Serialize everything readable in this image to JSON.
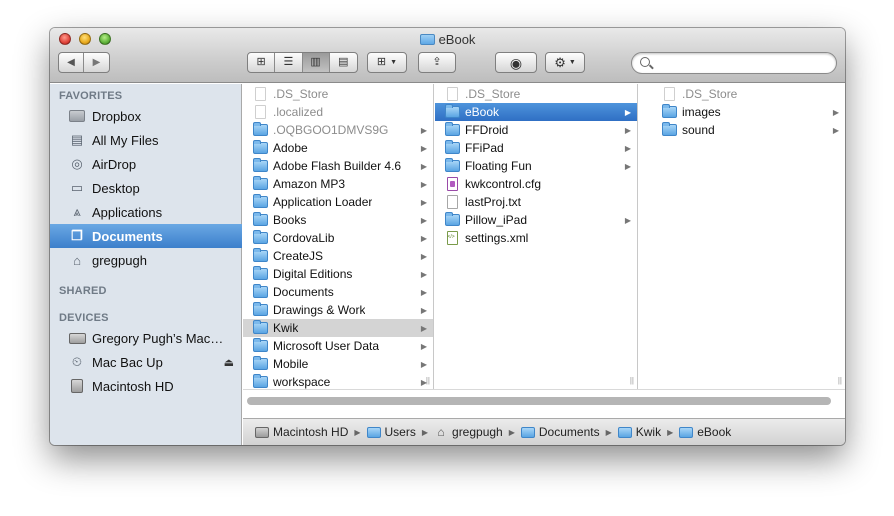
{
  "window": {
    "title": "eBook"
  },
  "toolbar": {
    "back_icon": "back-arrow-icon",
    "forward_icon": "forward-arrow-icon",
    "view_modes": [
      "icon-view",
      "list-view",
      "column-view",
      "cover-flow-view"
    ],
    "active_view": "column-view",
    "search": {
      "value": "",
      "placeholder": ""
    }
  },
  "sidebar": {
    "favorites_header": "FAVORITES",
    "favorites": [
      {
        "label": "Dropbox",
        "icon": "folder-icon"
      },
      {
        "label": "All My Files",
        "icon": "all-files-icon"
      },
      {
        "label": "AirDrop",
        "icon": "airdrop-icon"
      },
      {
        "label": "Desktop",
        "icon": "desktop-icon"
      },
      {
        "label": "Applications",
        "icon": "applications-icon"
      },
      {
        "label": "Documents",
        "icon": "documents-icon",
        "selected": true
      },
      {
        "label": "gregpugh",
        "icon": "home-icon"
      }
    ],
    "shared_header": "SHARED",
    "devices_header": "DEVICES",
    "devices": [
      {
        "label": "Gregory Pugh’s Mac…",
        "icon": "laptop-icon"
      },
      {
        "label": "Mac Bac Up",
        "icon": "external-disk-icon",
        "eject": "⏏"
      },
      {
        "label": "Macintosh HD",
        "icon": "hard-disk-icon"
      }
    ]
  },
  "columns": [
    {
      "items": [
        {
          "name": ".DS_Store",
          "type": "file",
          "dim": true
        },
        {
          "name": ".localized",
          "type": "file",
          "dim": true
        },
        {
          "name": ".OQBGOO1DMVS9G",
          "type": "folder",
          "dim": true,
          "chevron": true
        },
        {
          "name": "Adobe",
          "type": "folder",
          "chevron": true
        },
        {
          "name": "Adobe Flash Builder 4.6",
          "type": "folder",
          "chevron": true
        },
        {
          "name": "Amazon MP3",
          "type": "folder",
          "chevron": true
        },
        {
          "name": "Application Loader",
          "type": "folder",
          "chevron": true
        },
        {
          "name": "Books",
          "type": "folder",
          "chevron": true
        },
        {
          "name": "CordovaLib",
          "type": "folder",
          "chevron": true
        },
        {
          "name": "CreateJS",
          "type": "folder",
          "chevron": true
        },
        {
          "name": "Digital Editions",
          "type": "folder",
          "chevron": true
        },
        {
          "name": "Documents",
          "type": "folder",
          "chevron": true
        },
        {
          "name": "Drawings & Work",
          "type": "folder",
          "chevron": true
        },
        {
          "name": "Kwik",
          "type": "folder",
          "chevron": true,
          "selected": "gray"
        },
        {
          "name": "Microsoft User Data",
          "type": "folder",
          "chevron": true
        },
        {
          "name": "Mobile",
          "type": "folder",
          "chevron": true
        },
        {
          "name": "workspace",
          "type": "folder",
          "chevron": true
        }
      ]
    },
    {
      "items": [
        {
          "name": ".DS_Store",
          "type": "file",
          "dim": true
        },
        {
          "name": "eBook",
          "type": "folder",
          "chevron": true,
          "selected": "blue"
        },
        {
          "name": "FFDroid",
          "type": "folder",
          "chevron": true
        },
        {
          "name": "FFiPad",
          "type": "folder",
          "chevron": true
        },
        {
          "name": "Floating Fun",
          "type": "folder",
          "chevron": true
        },
        {
          "name": "kwkcontrol.cfg",
          "type": "cfg"
        },
        {
          "name": "lastProj.txt",
          "type": "file"
        },
        {
          "name": "Pillow_iPad",
          "type": "folder",
          "chevron": true
        },
        {
          "name": "settings.xml",
          "type": "xml"
        }
      ]
    },
    {
      "items": [
        {
          "name": ".DS_Store",
          "type": "file",
          "dim": true
        },
        {
          "name": "images",
          "type": "folder",
          "chevron": true
        },
        {
          "name": "sound",
          "type": "folder",
          "chevron": true
        }
      ]
    }
  ],
  "pathbar": [
    {
      "label": "Macintosh HD",
      "icon": "hard-disk-icon"
    },
    {
      "label": "Users",
      "icon": "folder-icon"
    },
    {
      "label": "gregpugh",
      "icon": "home-icon"
    },
    {
      "label": "Documents",
      "icon": "folder-icon"
    },
    {
      "label": "Kwik",
      "icon": "folder-icon"
    },
    {
      "label": "eBook",
      "icon": "folder-icon"
    }
  ]
}
